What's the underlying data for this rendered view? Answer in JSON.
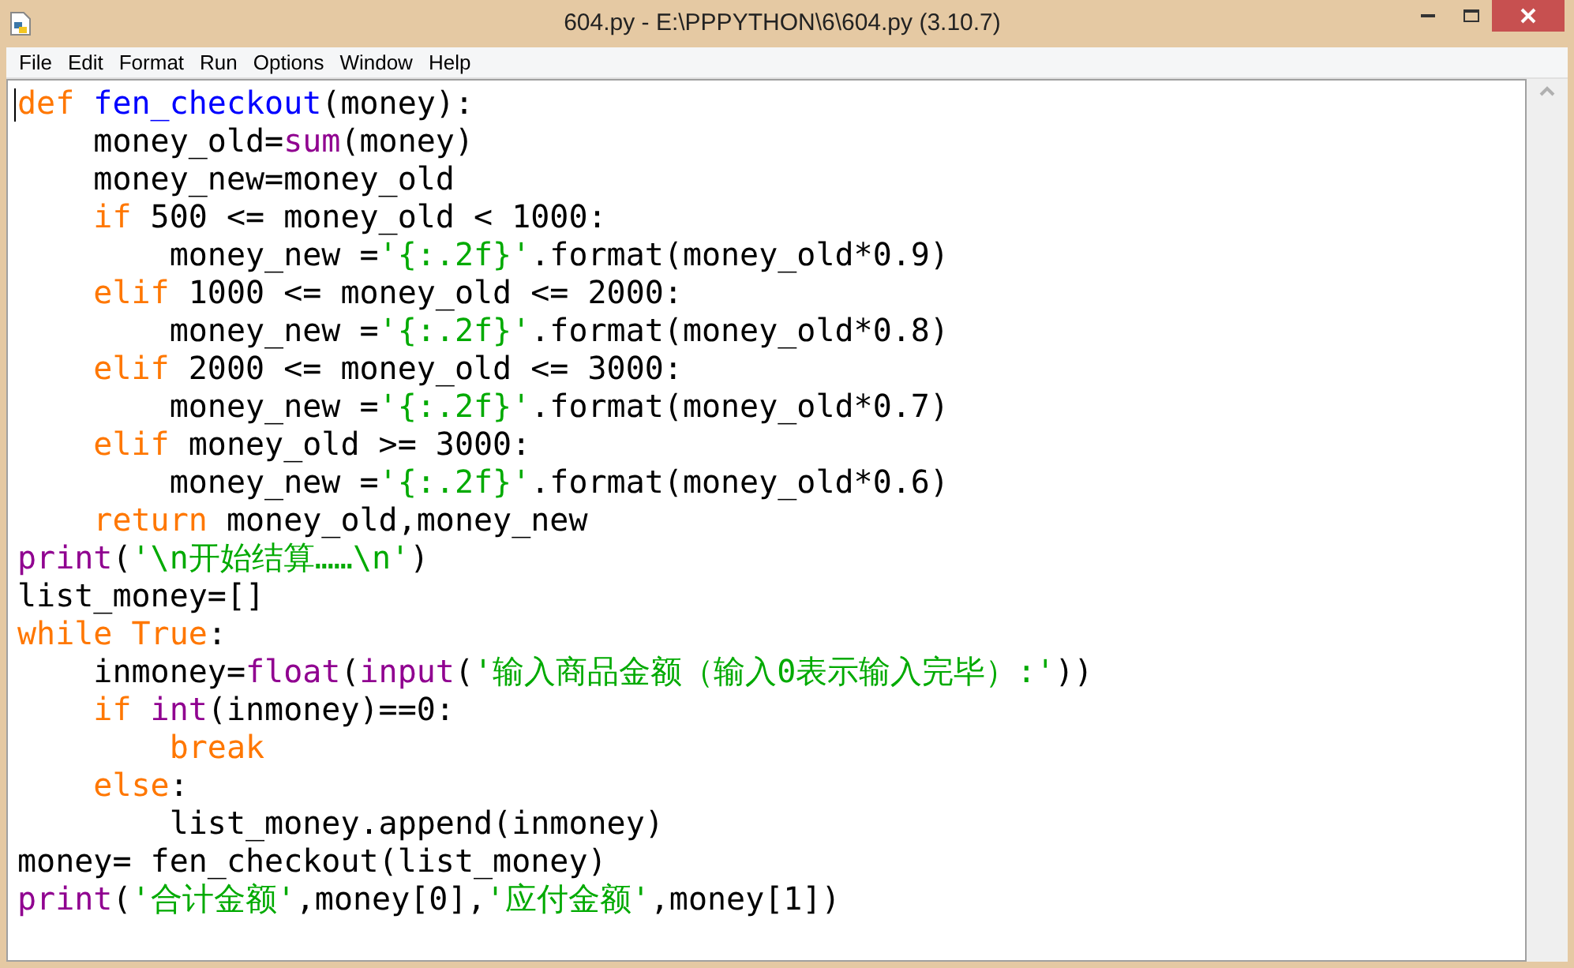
{
  "window": {
    "title": "604.py - E:\\PPPYTHON\\6\\604.py (3.10.7)"
  },
  "menu": [
    "File",
    "Edit",
    "Format",
    "Run",
    "Options",
    "Window",
    "Help"
  ],
  "code_lines": [
    [
      {
        "kind": "keyword",
        "text": "def"
      },
      {
        "kind": "definition",
        "text": " fen_checkout"
      },
      {
        "kind": "plain",
        "text": "(money):"
      }
    ],
    [
      {
        "kind": "plain",
        "text": "    money_old="
      },
      {
        "kind": "builtin",
        "text": "sum"
      },
      {
        "kind": "plain",
        "text": "(money)"
      }
    ],
    [
      {
        "kind": "plain",
        "text": "    money_new=money_old"
      }
    ],
    [
      {
        "kind": "keyword",
        "text": "    if"
      },
      {
        "kind": "plain",
        "text": " 500 <= money_old < 1000:"
      }
    ],
    [
      {
        "kind": "plain",
        "text": "        money_new ="
      },
      {
        "kind": "string",
        "text": "'{:.2f}'"
      },
      {
        "kind": "plain",
        "text": ".format(money_old*0.9)"
      }
    ],
    [
      {
        "kind": "keyword",
        "text": "    elif"
      },
      {
        "kind": "plain",
        "text": " 1000 <= money_old <= 2000:"
      }
    ],
    [
      {
        "kind": "plain",
        "text": "        money_new ="
      },
      {
        "kind": "string",
        "text": "'{:.2f}'"
      },
      {
        "kind": "plain",
        "text": ".format(money_old*0.8)"
      }
    ],
    [
      {
        "kind": "keyword",
        "text": "    elif"
      },
      {
        "kind": "plain",
        "text": " 2000 <= money_old <= 3000:"
      }
    ],
    [
      {
        "kind": "plain",
        "text": "        money_new ="
      },
      {
        "kind": "string",
        "text": "'{:.2f}'"
      },
      {
        "kind": "plain",
        "text": ".format(money_old*0.7)"
      }
    ],
    [
      {
        "kind": "keyword",
        "text": "    elif"
      },
      {
        "kind": "plain",
        "text": " money_old >= 3000:"
      }
    ],
    [
      {
        "kind": "plain",
        "text": "        money_new ="
      },
      {
        "kind": "string",
        "text": "'{:.2f}'"
      },
      {
        "kind": "plain",
        "text": ".format(money_old*0.6)"
      }
    ],
    [
      {
        "kind": "keyword",
        "text": "    return"
      },
      {
        "kind": "plain",
        "text": " money_old,money_new"
      }
    ],
    [
      {
        "kind": "builtin",
        "text": "print"
      },
      {
        "kind": "plain",
        "text": "("
      },
      {
        "kind": "string",
        "text": "'\\n开始结算……\\n'"
      },
      {
        "kind": "plain",
        "text": ")"
      }
    ],
    [
      {
        "kind": "plain",
        "text": "list_money=[]"
      }
    ],
    [
      {
        "kind": "keyword",
        "text": "while"
      },
      {
        "kind": "keyword",
        "text": " True"
      },
      {
        "kind": "plain",
        "text": ":"
      }
    ],
    [
      {
        "kind": "plain",
        "text": "    inmoney="
      },
      {
        "kind": "builtin",
        "text": "float"
      },
      {
        "kind": "plain",
        "text": "("
      },
      {
        "kind": "builtin",
        "text": "input"
      },
      {
        "kind": "plain",
        "text": "("
      },
      {
        "kind": "string",
        "text": "'输入商品金额（输入0表示输入完毕）:'"
      },
      {
        "kind": "plain",
        "text": "))"
      }
    ],
    [
      {
        "kind": "keyword",
        "text": "    if"
      },
      {
        "kind": "builtin",
        "text": " int"
      },
      {
        "kind": "plain",
        "text": "(inmoney)==0:"
      }
    ],
    [
      {
        "kind": "keyword",
        "text": "        break"
      }
    ],
    [
      {
        "kind": "keyword",
        "text": "    else"
      },
      {
        "kind": "plain",
        "text": ":"
      }
    ],
    [
      {
        "kind": "plain",
        "text": "        list_money.append(inmoney)"
      }
    ],
    [
      {
        "kind": "plain",
        "text": "money= fen_checkout(list_money)"
      }
    ],
    [
      {
        "kind": "builtin",
        "text": "print"
      },
      {
        "kind": "plain",
        "text": "("
      },
      {
        "kind": "string",
        "text": "'合计金额'"
      },
      {
        "kind": "plain",
        "text": ",money[0],"
      },
      {
        "kind": "string",
        "text": "'应付金额'"
      },
      {
        "kind": "plain",
        "text": ",money[1])"
      }
    ]
  ]
}
